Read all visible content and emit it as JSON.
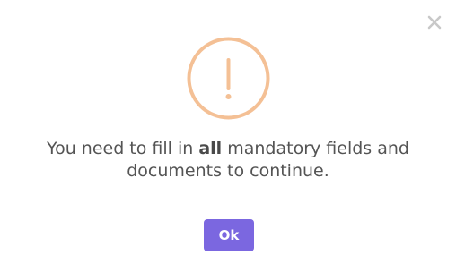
{
  "colors": {
    "warning": "#f4c095",
    "accent": "#7b67e0",
    "text": "#545454",
    "close": "#c8c8c8"
  },
  "icons": {
    "close": "close-icon",
    "warning": "warning-icon"
  },
  "message": {
    "before": "You need to fill in ",
    "emphasis": "all",
    "after": " mandatory fields and documents to continue."
  },
  "buttons": {
    "ok_label": "Ok"
  }
}
